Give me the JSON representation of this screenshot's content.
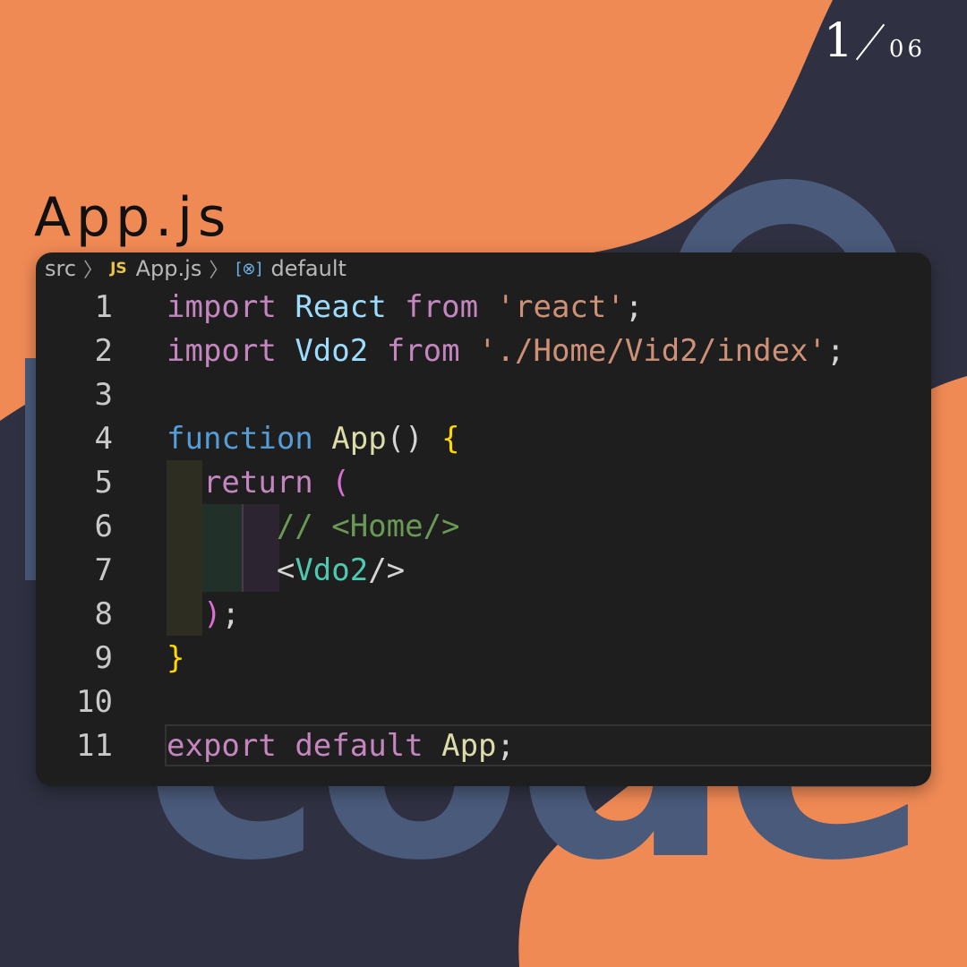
{
  "pager": {
    "current": "1",
    "total": "06"
  },
  "title": "App.js",
  "breadcrumb": {
    "folder": "src",
    "file_badge": "JS",
    "file": "App.js",
    "symbol_icon": "symbol-field-icon",
    "symbol": "default"
  },
  "lines": [
    {
      "n": "1",
      "tokens": [
        {
          "t": "import",
          "c": "kw"
        },
        {
          "t": " ",
          "c": "pun"
        },
        {
          "t": "React",
          "c": "id"
        },
        {
          "t": " ",
          "c": "pun"
        },
        {
          "t": "from",
          "c": "kw"
        },
        {
          "t": " ",
          "c": "pun"
        },
        {
          "t": "'react'",
          "c": "str"
        },
        {
          "t": ";",
          "c": "pun"
        }
      ]
    },
    {
      "n": "2",
      "tokens": [
        {
          "t": "import",
          "c": "kw"
        },
        {
          "t": " ",
          "c": "pun"
        },
        {
          "t": "Vdo2",
          "c": "id"
        },
        {
          "t": " ",
          "c": "pun"
        },
        {
          "t": "from",
          "c": "kw"
        },
        {
          "t": " ",
          "c": "pun"
        },
        {
          "t": "'./Home/Vid2/index'",
          "c": "str"
        },
        {
          "t": ";",
          "c": "pun"
        }
      ]
    },
    {
      "n": "3",
      "tokens": []
    },
    {
      "n": "4",
      "tokens": [
        {
          "t": "function",
          "c": "kw2"
        },
        {
          "t": " ",
          "c": "pun"
        },
        {
          "t": "App",
          "c": "fn"
        },
        {
          "t": "() ",
          "c": "pun"
        },
        {
          "t": "{",
          "c": "br"
        }
      ]
    },
    {
      "n": "5",
      "tokens": [
        {
          "t": "  return",
          "c": "kw"
        },
        {
          "t": " ",
          "c": "pun"
        },
        {
          "t": "(",
          "c": "br2"
        }
      ]
    },
    {
      "n": "6",
      "tokens": [
        {
          "t": "      // <Home/>",
          "c": "cmt"
        }
      ]
    },
    {
      "n": "7",
      "tokens": [
        {
          "t": "      ",
          "c": "pun"
        },
        {
          "t": "<",
          "c": "pun"
        },
        {
          "t": "Vdo2",
          "c": "tag"
        },
        {
          "t": "/>",
          "c": "pun"
        }
      ]
    },
    {
      "n": "8",
      "tokens": [
        {
          "t": "  ",
          "c": "pun"
        },
        {
          "t": ")",
          "c": "br2"
        },
        {
          "t": ";",
          "c": "pun"
        }
      ]
    },
    {
      "n": "9",
      "tokens": [
        {
          "t": "}",
          "c": "br"
        }
      ]
    },
    {
      "n": "10",
      "tokens": []
    },
    {
      "n": "11",
      "tokens": [
        {
          "t": "export",
          "c": "kw"
        },
        {
          "t": " ",
          "c": "pun"
        },
        {
          "t": "default",
          "c": "kw"
        },
        {
          "t": " ",
          "c": "pun"
        },
        {
          "t": "App",
          "c": "fn"
        },
        {
          "t": ";",
          "c": "pun"
        }
      ],
      "active": true
    }
  ],
  "colors": {
    "background": "#f08a55",
    "dark_shape": "#2f3142",
    "watermark": "#4a5a7a",
    "editor": "#1e1e1e"
  },
  "watermark_text": "code"
}
